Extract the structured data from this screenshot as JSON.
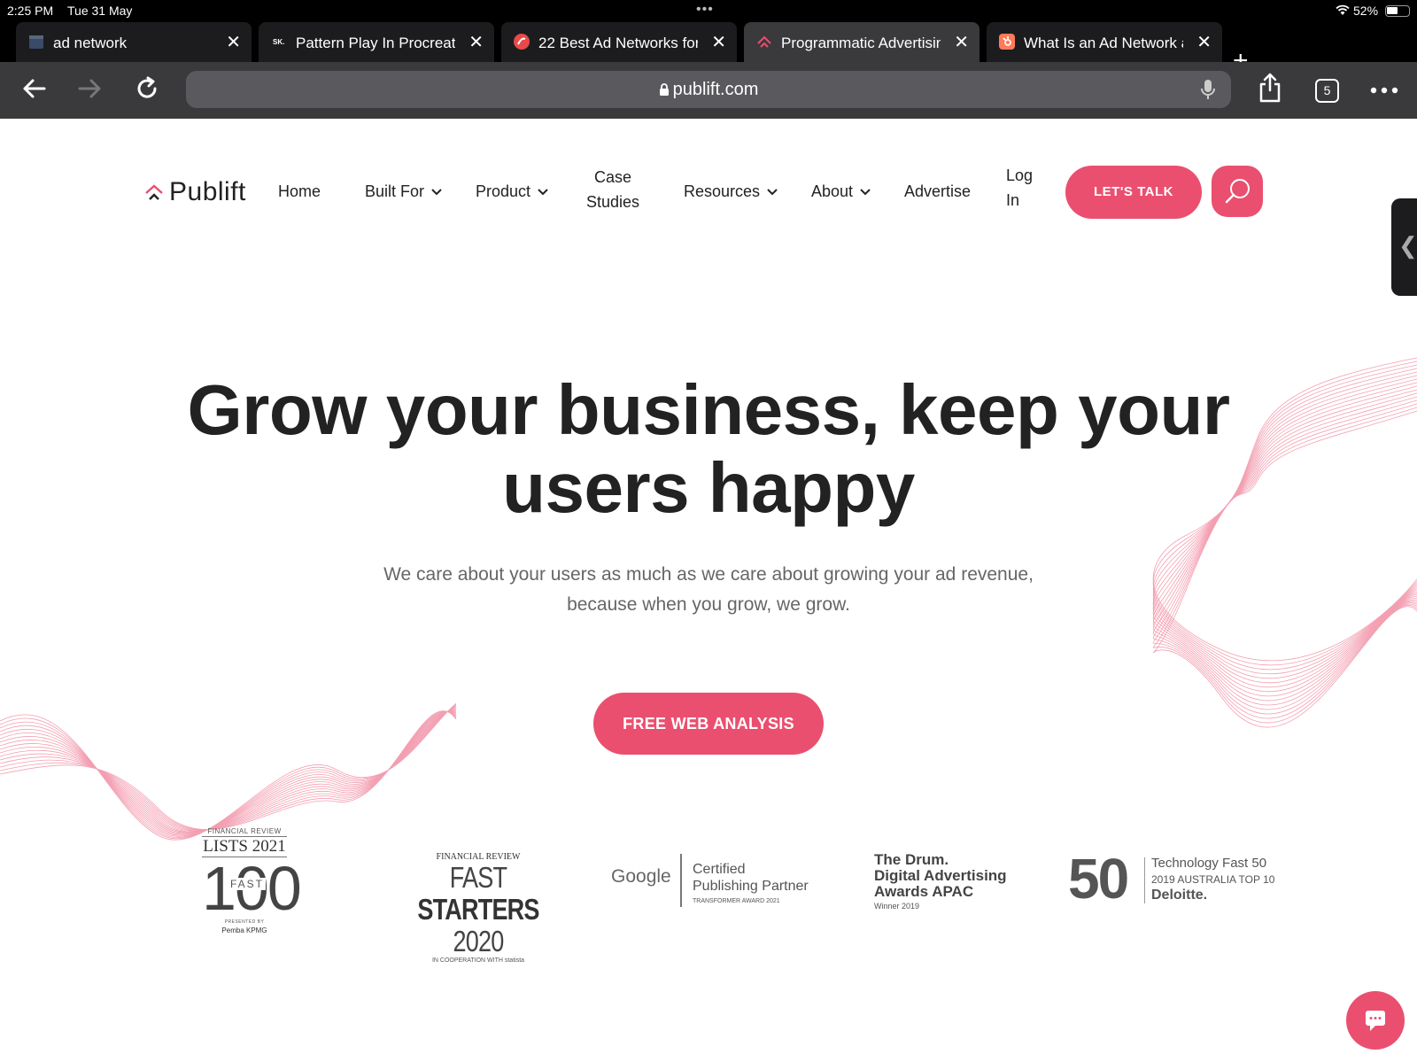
{
  "status_bar": {
    "time": "2:25 PM",
    "date": "Tue 31 May",
    "battery": "52%",
    "battery_level": 0.52
  },
  "tabs": [
    {
      "title": "ad network",
      "favicon": "calendar-icon",
      "active": false
    },
    {
      "title": "Pattern Play In Procreate",
      "favicon": "sk-icon",
      "active": false
    },
    {
      "title": "22 Best Ad Networks for",
      "favicon": "red-circle-icon",
      "active": false
    },
    {
      "title": "Programmatic Advertising",
      "favicon": "publift-icon",
      "active": true
    },
    {
      "title": "What Is an Ad Network ar",
      "favicon": "hubspot-icon",
      "active": false
    }
  ],
  "toolbar": {
    "url": "publift.com",
    "tab_count": "5"
  },
  "site": {
    "logo_text": "Publift",
    "nav": {
      "home": "Home",
      "built_for": "Built For",
      "product": "Product",
      "case_1": "Case",
      "case_2": "Studies",
      "resources": "Resources",
      "about": "About",
      "advertise": "Advertise",
      "login_1": "Log",
      "login_2": "In"
    },
    "cta_talk": "LET'S TALK",
    "accent_color": "#ea4f6f"
  },
  "hero": {
    "title_line1": "Grow your business, keep your",
    "title_line2": "users happy",
    "subtitle_line1": "We care about your users as much as we care about growing your ad revenue,",
    "subtitle_line2": "because when you grow, we grow.",
    "cta": "FREE WEB ANALYSIS"
  },
  "awards": {
    "afr_fast100": {
      "header": "FINANCIAL REVIEW",
      "lists": "LISTS 2021",
      "number": "100",
      "fast": "FAST",
      "presented": "PRESENTED BY",
      "sponsors": "Pemba   KPMG"
    },
    "afr_fast_starters": {
      "header": "FINANCIAL REVIEW",
      "fast": "FAST ",
      "starters": "STARTERS",
      "year": " 2020",
      "coop": "IN COOPERATION WITH statista"
    },
    "google": {
      "brand": "Google",
      "line1": "Certified",
      "line2": "Publishing Partner",
      "line3": "TRANSFORMER AWARD 2021"
    },
    "drum": {
      "line1": "The Drum.",
      "line2": "Digital Advertising",
      "line3": "Awards APAC",
      "winner": "Winner 2019"
    },
    "deloitte": {
      "number": "50",
      "line1": "Technology Fast 50",
      "line2": "2019 AUSTRALIA TOP 10",
      "line3": "Deloitte."
    }
  }
}
